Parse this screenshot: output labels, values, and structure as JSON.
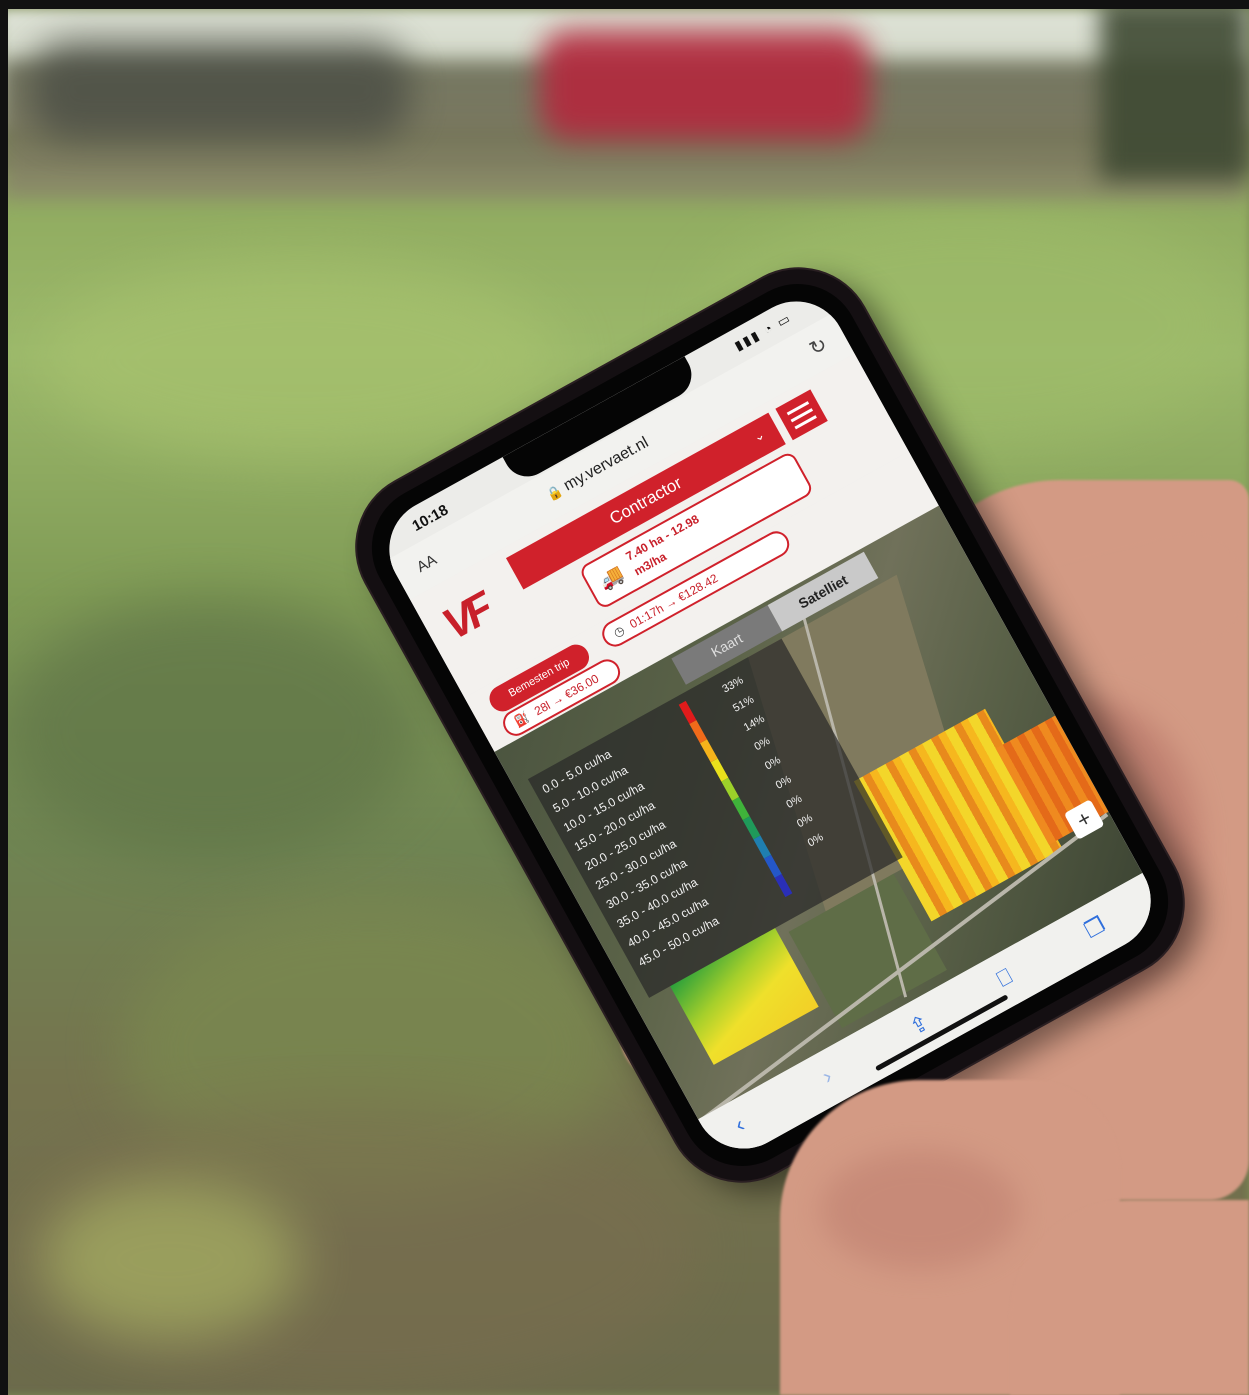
{
  "status": {
    "time": "10:18",
    "signal_icons": "signal-wifi-battery-icons"
  },
  "browser": {
    "text_size_label": "AA",
    "url": "my.vervaet.nl",
    "reload_icon": "reload-icon"
  },
  "app": {
    "brand_color": "#d0212b",
    "logo_text": "VF",
    "role_selector": "Contractor",
    "field_info_line1": "7.40 ha - 12.98",
    "field_info_line2": "m3/ha",
    "action_button": "Bemesten trip",
    "fuel_stat": "28l → €36.00",
    "time_stat": "01:17h → €128.42"
  },
  "map": {
    "toggle_left": "Kaart",
    "toggle_right": "Satelliet",
    "legend": [
      {
        "range": "0.0 - 5.0 cu/ha",
        "color": "#e11b1b",
        "pct": "33%"
      },
      {
        "range": "5.0 - 10.0 cu/ha",
        "color": "#f06a1a",
        "pct": "51%"
      },
      {
        "range": "10.0 - 15.0 cu/ha",
        "color": "#f5b31b",
        "pct": "14%"
      },
      {
        "range": "15.0 - 20.0 cu/ha",
        "color": "#e9e11c",
        "pct": "0%"
      },
      {
        "range": "20.0 - 25.0 cu/ha",
        "color": "#9cd12a",
        "pct": "0%"
      },
      {
        "range": "25.0 - 30.0 cu/ha",
        "color": "#3fb33a",
        "pct": "0%"
      },
      {
        "range": "30.0 - 35.0 cu/ha",
        "color": "#1f9a5a",
        "pct": "0%"
      },
      {
        "range": "35.0 - 40.0 cu/ha",
        "color": "#1f7fb0",
        "pct": "0%"
      },
      {
        "range": "40.0 - 45.0 cu/ha",
        "color": "#2457c8",
        "pct": "0%"
      },
      {
        "range": "45.0 - 50.0 cu/ha",
        "color": "#2a2fb8",
        "pct": ""
      }
    ],
    "zoom_in_label": "+"
  }
}
